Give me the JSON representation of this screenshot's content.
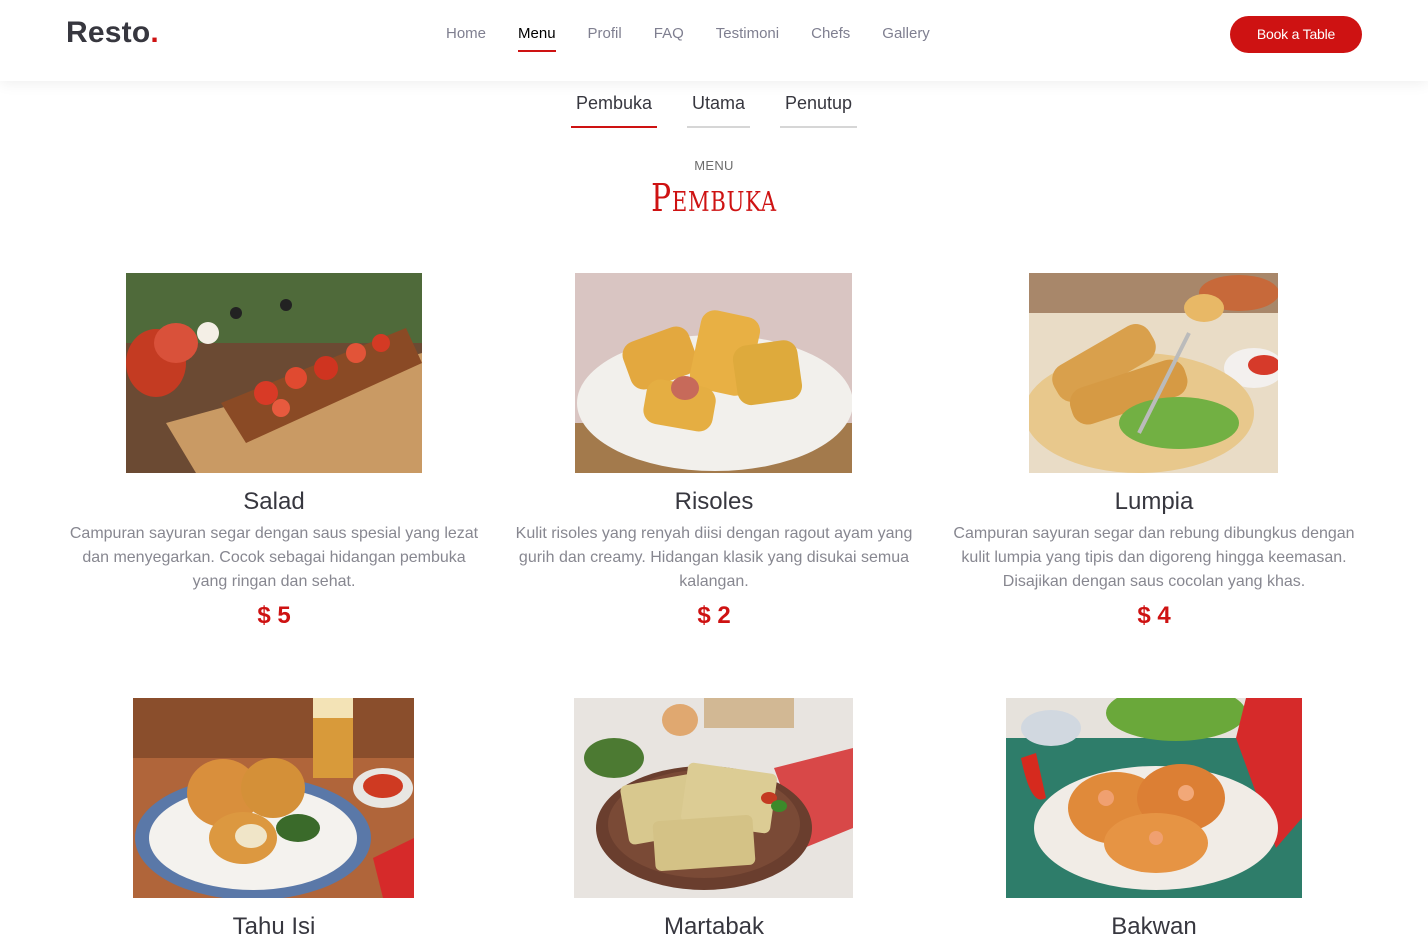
{
  "brand": {
    "name": "Resto",
    "dot": "."
  },
  "nav": {
    "items": [
      {
        "label": "Home"
      },
      {
        "label": "Menu"
      },
      {
        "label": "Profil"
      },
      {
        "label": "FAQ"
      },
      {
        "label": "Testimoni"
      },
      {
        "label": "Chefs"
      },
      {
        "label": "Gallery"
      }
    ],
    "active": "Menu",
    "book_label": "Book a Table"
  },
  "tabs": {
    "items": [
      {
        "label": "Pembuka"
      },
      {
        "label": "Utama"
      },
      {
        "label": "Penutup"
      }
    ],
    "active": "Pembuka"
  },
  "section": {
    "subtitle": "MENU",
    "title": "Pembuka"
  },
  "menu": [
    {
      "name": "Salad",
      "description": "Campuran sayuran segar dengan saus spesial yang lezat dan menyegarkan. Cocok sebagai hidangan pembuka yang ringan dan sehat.",
      "price": "$ 5"
    },
    {
      "name": "Risoles",
      "description": "Kulit risoles yang renyah diisi dengan ragout ayam yang gurih dan creamy. Hidangan klasik yang disukai semua kalangan.",
      "price": "$ 2"
    },
    {
      "name": "Lumpia",
      "description": "Campuran sayuran segar dan rebung dibungkus dengan kulit lumpia yang tipis dan digoreng hingga keemasan. Disajikan dengan saus cocolan yang khas.",
      "price": "$ 4"
    },
    {
      "name": "Tahu Isi"
    },
    {
      "name": "Martabak"
    },
    {
      "name": "Bakwan"
    }
  ],
  "colors": {
    "accent": "#ce1212",
    "text": "#37373f",
    "muted": "#7f7f90"
  }
}
